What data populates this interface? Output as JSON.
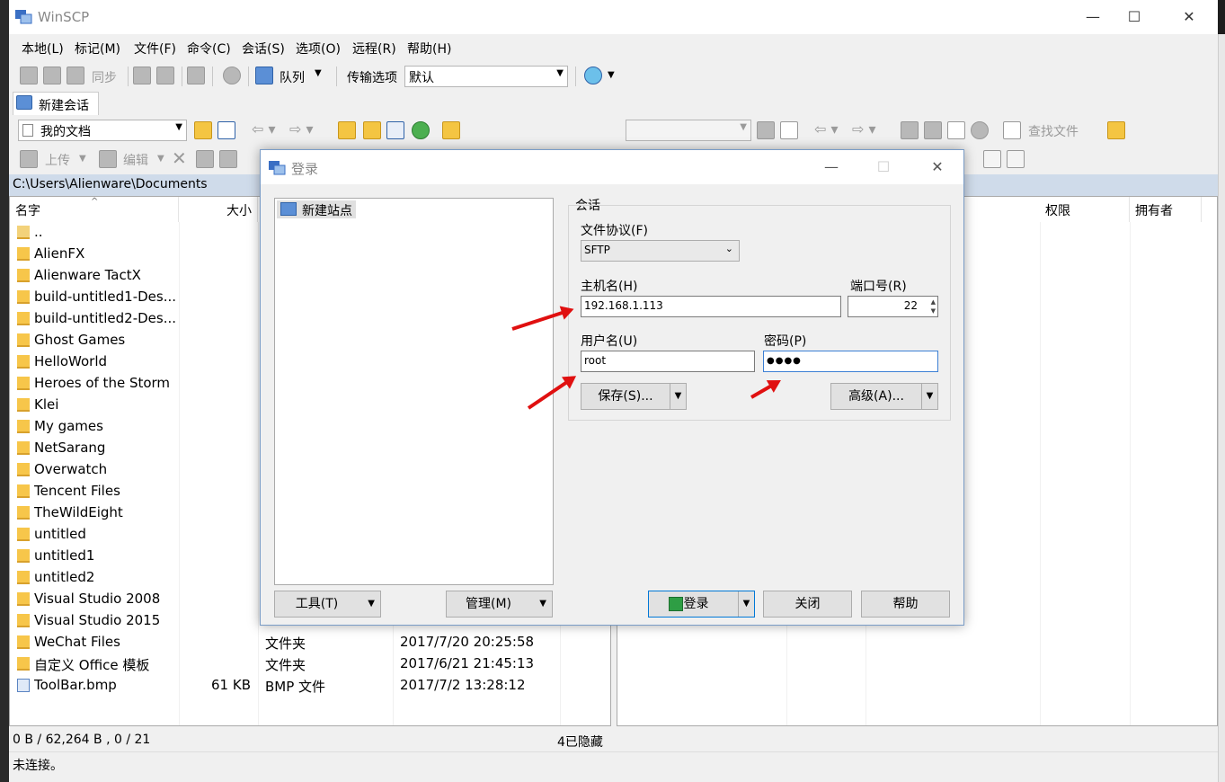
{
  "window": {
    "title": "WinSCP"
  },
  "menu": [
    "本地(L)",
    "标记(M)",
    "文件(F)",
    "命令(C)",
    "会话(S)",
    "选项(O)",
    "远程(R)",
    "帮助(H)"
  ],
  "toolbar1": {
    "sync": "同步",
    "queue": "队列",
    "transfer_options_label": "传输选项",
    "transfer_options_value": "默认"
  },
  "session_tab": "新建会话",
  "local": {
    "location": "我的文档",
    "upload": "上传",
    "edit": "编辑",
    "path": "C:\\Users\\Alienware\\Documents",
    "find_files": "查找文件",
    "columns": [
      "名字",
      "大小"
    ],
    "files": [
      {
        "name": ".."
      },
      {
        "name": "AlienFX"
      },
      {
        "name": "Alienware TactX"
      },
      {
        "name": "build-untitled1-Des..."
      },
      {
        "name": "build-untitled2-Des..."
      },
      {
        "name": "Ghost Games"
      },
      {
        "name": "HelloWorld"
      },
      {
        "name": "Heroes of the Storm"
      },
      {
        "name": "Klei"
      },
      {
        "name": "My games"
      },
      {
        "name": "NetSarang"
      },
      {
        "name": "Overwatch"
      },
      {
        "name": "Tencent Files"
      },
      {
        "name": "TheWildEight"
      },
      {
        "name": "untitled"
      },
      {
        "name": "untitled1"
      },
      {
        "name": "untitled2"
      },
      {
        "name": "Visual Studio 2008"
      },
      {
        "name": "Visual Studio 2015"
      },
      {
        "name": "WeChat Files",
        "type": "文件夹",
        "date": "2017/7/20  20:25:58"
      },
      {
        "name": "自定义 Office 模板",
        "type": "文件夹",
        "date": "2017/6/21  21:45:13"
      },
      {
        "name": "ToolBar.bmp",
        "size": "61 KB",
        "type": "BMP 文件",
        "date": "2017/7/2  13:28:12"
      }
    ]
  },
  "remote": {
    "columns": [
      "权限",
      "拥有者"
    ]
  },
  "status": {
    "selection": "0 B / 62,264 B ,  0 / 21",
    "hidden": "4已隐藏",
    "connection": "未连接。"
  },
  "dialog": {
    "title": "登录",
    "new_site": "新建站点",
    "session_group": "会话",
    "protocol_label": "文件协议(F)",
    "protocol_value": "SFTP",
    "host_label": "主机名(H)",
    "host_value": "192.168.1.113",
    "port_label": "端口号(R)",
    "port_value": "22",
    "user_label": "用户名(U)",
    "user_value": "root",
    "password_label": "密码(P)",
    "password_value": "●●●●",
    "save": "保存(S)...",
    "advanced": "高级(A)...",
    "tools": "工具(T)",
    "manage": "管理(M)",
    "login": "登录",
    "close": "关闭",
    "help": "帮助"
  }
}
